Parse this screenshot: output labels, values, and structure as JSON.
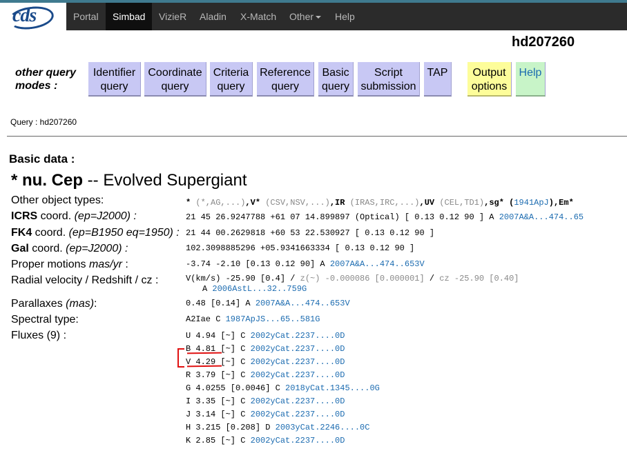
{
  "nav": {
    "logo": "cds",
    "items": [
      "Portal",
      "Simbad",
      "VizieR",
      "Aladin",
      "X-Match",
      "Other",
      "Help"
    ]
  },
  "page_title": "hd207260",
  "query_modes": {
    "label_line1": "other query",
    "label_line2": "modes :",
    "buttons": [
      {
        "l1": "Identifier",
        "l2": "query"
      },
      {
        "l1": "Coordinate",
        "l2": "query"
      },
      {
        "l1": "Criteria",
        "l2": "query"
      },
      {
        "l1": "Reference",
        "l2": "query"
      },
      {
        "l1": "Basic",
        "l2": "query"
      },
      {
        "l1": "Script",
        "l2": "submission"
      },
      {
        "l1": "TAP",
        "l2": ""
      },
      {
        "l1": "Output",
        "l2": "options"
      },
      {
        "l1": "Help",
        "l2": ""
      }
    ]
  },
  "query_line": "Query : hd207260",
  "basic_title": "Basic data :",
  "object": {
    "name": "* nu. Cep",
    "sep": " -- ",
    "type": "Evolved Supergiant"
  },
  "rows": {
    "other_types": {
      "label": "Other object types:",
      "v1": "* ",
      "v2": "(*,AG,...)",
      "v3": ",V* ",
      "v4": "(CSV,NSV,...)",
      "v5": ",IR ",
      "v6": "(IRAS,IRC,...)",
      "v7": ",UV ",
      "v8": "(CEL,TD1)",
      "v9": ",sg* (",
      "v10": "1941ApJ",
      "v11": "),Em*"
    },
    "icrs": {
      "label_b": "ICRS",
      "label": " coord. ",
      "label_i": "(ep=J2000) :",
      "value": "21 45 26.9247788 +61 07 14.899897 (Optical) [ 0.13 0.12 90 ] A ",
      "link": "2007A&A...474..65"
    },
    "fk4": {
      "label_b": "FK4",
      "label": " coord. ",
      "label_i": "(ep=B1950 eq=1950) :",
      "value": "21 44 00.2629818 +60 53 22.530927 [ 0.13 0.12 90 ]"
    },
    "gal": {
      "label_b": "Gal",
      "label": " coord. ",
      "label_i": "(ep=J2000) :",
      "value": "102.3098885296 +05.9341663334 [ 0.13 0.12 90 ]"
    },
    "pm": {
      "label": "Proper motions ",
      "label_i": "mas/yr",
      "label_end": " :",
      "value": "-3.74 -2.10 [0.13 0.12 90] A ",
      "link": "2007A&A...474..653V"
    },
    "rv": {
      "label": "Radial velocity / Redshift / cz :",
      "value_a": "V(km/s) -25.90 [0.4] / ",
      "value_z": "z(~) -0.000086 [0.000001]",
      "value_b": " / ",
      "value_cz": "cz -25.90 [0.40]",
      "line2": "A ",
      "link": "2006AstL...32..759G"
    },
    "plx": {
      "label": "Parallaxes ",
      "label_i": "(mas)",
      "label_end": ":",
      "value": "0.48 [0.14] A ",
      "link": "2007A&A...474..653V"
    },
    "sp": {
      "label": "Spectral type:",
      "value": "A2Iae C ",
      "link": "1987ApJS...65..581G"
    },
    "fluxes_label": "Fluxes (9) :"
  },
  "fluxes": [
    {
      "text": "U 4.94 [~] C ",
      "link": "2002yCat.2237....0D"
    },
    {
      "text": "B 4.81 [~] C ",
      "link": "2002yCat.2237....0D"
    },
    {
      "text": "V 4.29 [~] C ",
      "link": "2002yCat.2237....0D"
    },
    {
      "text": "R 3.79 [~] C ",
      "link": "2002yCat.2237....0D"
    },
    {
      "text": "G 4.0255 [0.0046] C ",
      "link": "2018yCat.1345....0G"
    },
    {
      "text": "I 3.35 [~] C ",
      "link": "2002yCat.2237....0D"
    },
    {
      "text": "J 3.14 [~] C ",
      "link": "2002yCat.2237....0D"
    },
    {
      "text": "H 3.215 [0.208] D ",
      "link": "2003yCat.2246....0C"
    },
    {
      "text": "K 2.85 [~] C ",
      "link": "2002yCat.2237....0D"
    }
  ]
}
